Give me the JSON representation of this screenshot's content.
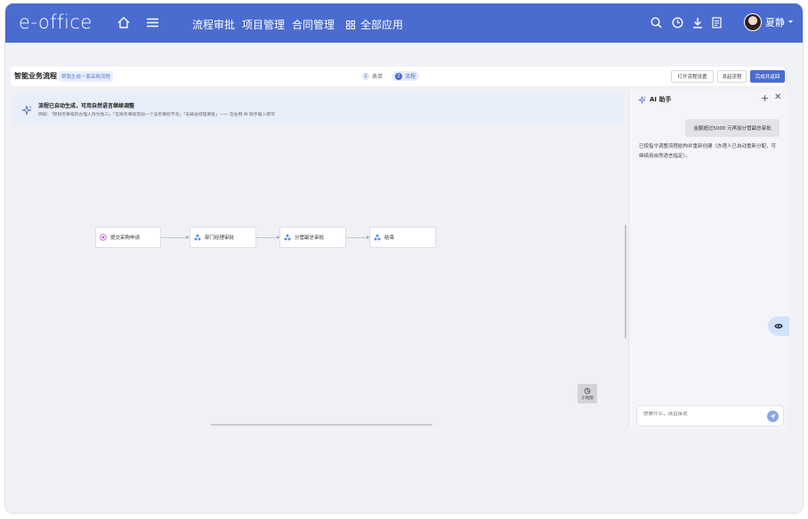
{
  "header": {
    "logo": "e-office",
    "nav": [
      "流程审批",
      "项目管理",
      "合同管理"
    ],
    "all_apps": "全部应用",
    "user_name": "夏静"
  },
  "toolbar": {
    "title": "智能业务流程",
    "tag": "帮我生成一套采购流程",
    "steps": [
      {
        "num": "1",
        "label": "表单"
      },
      {
        "num": "2",
        "label": "流程"
      }
    ],
    "buttons": [
      "打开流程设置",
      "发起流程",
      "完成并返回"
    ]
  },
  "banner": {
    "title": "流程已自动生成，可用自然语言继续调整",
    "subtitle": "例如：「把财务审核的办理人改为张三」「在财务审核前加一个法务审批节点」「去掉总经理审批」—— 在右侧 AI 助手输入即可"
  },
  "flow": {
    "nodes": [
      "提交采购申请",
      "部门经理审批",
      "分管副总审批",
      "结束"
    ]
  },
  "minimap": {
    "label": "小地图"
  },
  "ai": {
    "title": "AI 助手",
    "user_message": "金额超过5000 元再加分管副总审批",
    "reply": "已按指令调整流程结构并重新创建（办理人已自动重新分配，可继续用自然语言指定）。",
    "input_placeholder": "想做什么，请直接说"
  }
}
